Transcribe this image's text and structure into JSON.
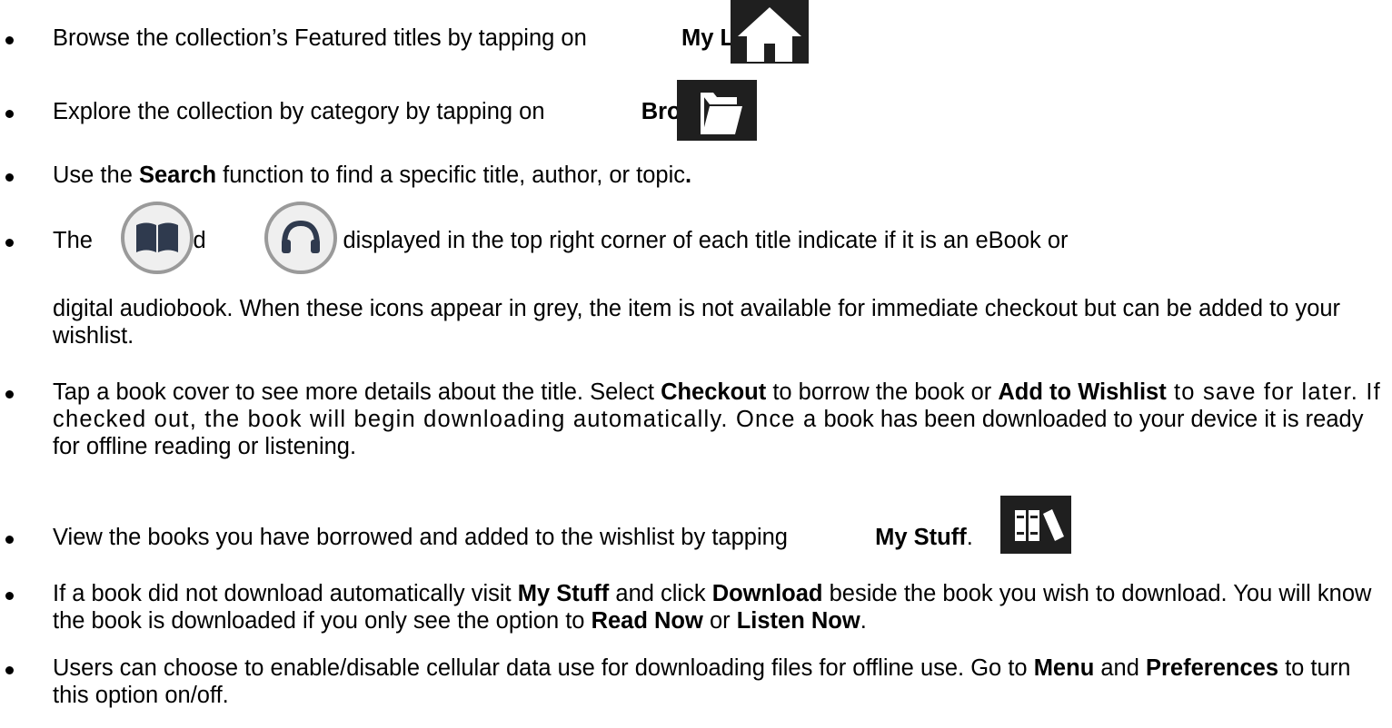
{
  "bullets": [
    {
      "pre": "Browse the collection’s Featured titles by tapping on ",
      "icon": "home-icon",
      "label": "My Library."
    },
    {
      "pre": "Explore the collection by category by tapping on ",
      "icon": "folder-icon",
      "label": "Browse."
    },
    {
      "pre": "Use the ",
      "b1": "Search",
      "post": " function to find a specific title, author, or topic",
      "b2": "."
    },
    {
      "pre": "The ",
      "mid": " and ",
      "post": " icons displayed in the top right corner of each title indicate if it is an eBook or",
      "cont": "digital audiobook. When these icons appear in grey, the item is not available for immediate checkout but can be added to your wishlist.",
      "icon1": "ebook-icon",
      "icon2": "headphones-icon"
    },
    {
      "pre": "Tap a book cover to see more details about the title.  Select ",
      "b1": "Checkout",
      "mid": " to borrow the book or ",
      "b2": "Add to Wishlist",
      "post": " to save for later.  If checked out, the book will begin downloading automatically.  Once a",
      "tail": "book has been downloaded to your device it is ready for offline reading or listening."
    },
    {
      "pre": "View the books you have borrowed and added to the wishlist by tapping ",
      "icon": "bookshelf-icon",
      "label": "My Stuff",
      "post": "."
    },
    {
      "pre": "If a book did not download automatically visit ",
      "b1": "My Stuff",
      "mid": " and click ",
      "b2": "Download",
      "post": " beside the book you wish to download.  You will know the book is downloaded if you only see the option to ",
      "b3": "Read Now",
      "or": " or ",
      "b4": "Listen Now",
      "end": "."
    },
    {
      "pre": "Users can choose to enable/disable cellular data use for downloading files for offline use.  Go to ",
      "b1": "Menu",
      "mid": " and ",
      "b2": "Preferences",
      "post": " to turn this option on/off."
    }
  ]
}
